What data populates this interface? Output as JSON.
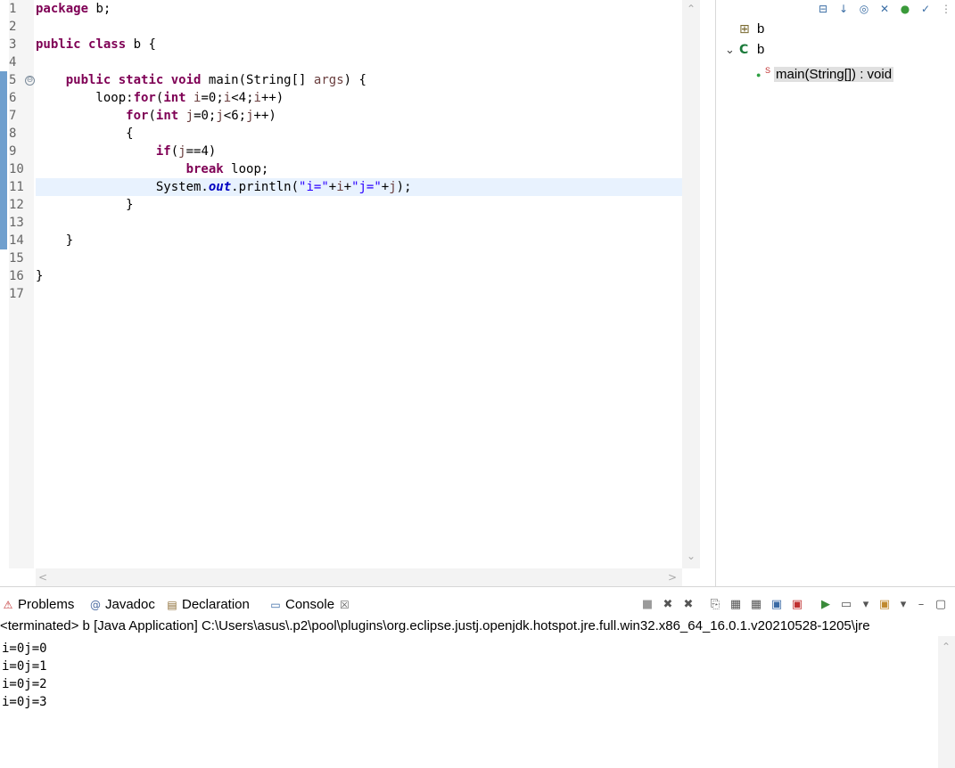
{
  "editor": {
    "line_numbers": [
      "1",
      "2",
      "3",
      "4",
      "5",
      "6",
      "7",
      "8",
      "9",
      "10",
      "11",
      "12",
      "13",
      "14",
      "15",
      "16",
      "17"
    ],
    "lines": [
      [
        {
          "t": "package",
          "c": "kw"
        },
        {
          "t": " b;"
        }
      ],
      [],
      [
        {
          "t": "public",
          "c": "kw"
        },
        {
          "t": " "
        },
        {
          "t": "class",
          "c": "kw"
        },
        {
          "t": " b {"
        }
      ],
      [],
      [
        {
          "t": "    "
        },
        {
          "t": "public",
          "c": "kw"
        },
        {
          "t": " "
        },
        {
          "t": "static",
          "c": "kw"
        },
        {
          "t": " "
        },
        {
          "t": "void",
          "c": "kw"
        },
        {
          "t": " main(String[] "
        },
        {
          "t": "args",
          "c": "var"
        },
        {
          "t": ") {"
        }
      ],
      [
        {
          "t": "        loop:"
        },
        {
          "t": "for",
          "c": "kw"
        },
        {
          "t": "("
        },
        {
          "t": "int",
          "c": "kw"
        },
        {
          "t": " "
        },
        {
          "t": "i",
          "c": "var"
        },
        {
          "t": "=0;"
        },
        {
          "t": "i",
          "c": "var"
        },
        {
          "t": "<4;"
        },
        {
          "t": "i",
          "c": "var"
        },
        {
          "t": "++)"
        }
      ],
      [
        {
          "t": "            "
        },
        {
          "t": "for",
          "c": "kw"
        },
        {
          "t": "("
        },
        {
          "t": "int",
          "c": "kw"
        },
        {
          "t": " "
        },
        {
          "t": "j",
          "c": "var"
        },
        {
          "t": "=0;"
        },
        {
          "t": "j",
          "c": "var"
        },
        {
          "t": "<6;"
        },
        {
          "t": "j",
          "c": "var"
        },
        {
          "t": "++)"
        }
      ],
      [
        {
          "t": "            {"
        }
      ],
      [
        {
          "t": "                "
        },
        {
          "t": "if",
          "c": "kw"
        },
        {
          "t": "("
        },
        {
          "t": "j",
          "c": "var"
        },
        {
          "t": "==4)"
        }
      ],
      [
        {
          "t": "                    "
        },
        {
          "t": "break",
          "c": "kw"
        },
        {
          "t": " loop;"
        }
      ],
      [
        {
          "t": "                System."
        },
        {
          "t": "out",
          "c": "fld"
        },
        {
          "t": ".println("
        },
        {
          "t": "\"i=\"",
          "c": "str"
        },
        {
          "t": "+"
        },
        {
          "t": "i",
          "c": "var"
        },
        {
          "t": "+"
        },
        {
          "t": "\"j=\"",
          "c": "str"
        },
        {
          "t": "+"
        },
        {
          "t": "j",
          "c": "var"
        },
        {
          "t": ");"
        }
      ],
      [
        {
          "t": "            }"
        }
      ],
      [],
      [
        {
          "t": "    }"
        }
      ],
      [],
      [
        {
          "t": "}"
        }
      ],
      []
    ],
    "current_line": 11,
    "fold_marker_line": 5,
    "fold_symbol": "⊖"
  },
  "outline": {
    "toolbar_icons": [
      "collapse-all-icon",
      "sort-icon",
      "hide-fields-icon",
      "hide-static-icon",
      "hide-nonpublic-icon",
      "hide-local-types-icon",
      "view-menu-icon"
    ],
    "toolbar_glyphs": [
      "⊟",
      "↓",
      "◎",
      "✕",
      "●",
      "✓",
      "⋮"
    ],
    "items": [
      {
        "label": "b",
        "icon": "import-declarations-icon",
        "glyph": "⊞",
        "expand": ""
      },
      {
        "label": "b",
        "icon": "class-icon",
        "glyph": "C",
        "expand": "⌄"
      },
      {
        "label": "main(String[]) : void",
        "icon": "public-static-method-icon",
        "glyph": "●",
        "modifier": "S",
        "expand": ""
      }
    ]
  },
  "panel": {
    "tabs": [
      {
        "label": "Problems",
        "icon": "problems-icon",
        "glyph": "⚠"
      },
      {
        "label": "Javadoc",
        "icon": "javadoc-icon",
        "glyph": "@"
      },
      {
        "label": "Declaration",
        "icon": "declaration-icon",
        "glyph": "▤"
      },
      {
        "label": "Console",
        "icon": "console-icon",
        "glyph": "▭",
        "close": "☒"
      }
    ],
    "toolbar_glyphs": [
      "■",
      "✖",
      "✖",
      "⎘",
      "▦",
      "▦",
      "▣",
      "▣",
      "▶",
      "▭",
      "▾",
      "▣",
      "▾",
      "–",
      "▢"
    ],
    "status": "<terminated> b [Java Application] C:\\Users\\asus\\.p2\\pool\\plugins\\org.eclipse.justj.openjdk.hotspot.jre.full.win32.x86_64_16.0.1.v20210528-1205\\jre",
    "output": [
      "i=0j=0",
      "i=0j=1",
      "i=0j=2",
      "i=0j=3"
    ]
  },
  "scroll": {
    "up": "⌃",
    "down": "⌄",
    "left": "<",
    "right": ">"
  }
}
